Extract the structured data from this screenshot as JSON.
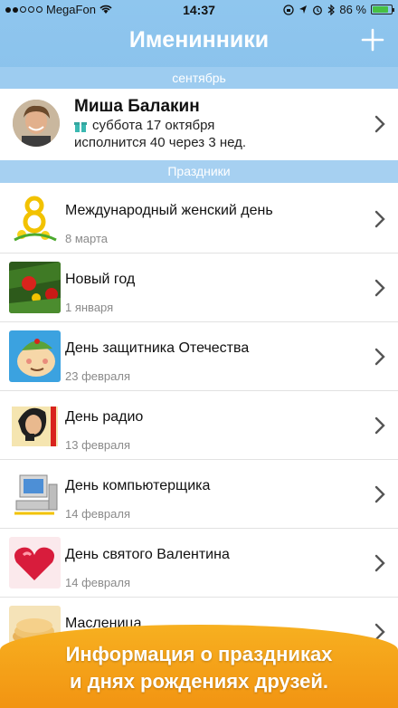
{
  "status_bar": {
    "carrier": "MegaFon",
    "time": "14:37",
    "battery": "86 %",
    "battery_level": 0.86
  },
  "header": {
    "title": "Именинники",
    "add_icon": "plus-icon"
  },
  "birthdays": {
    "section_label": "сентябрь",
    "person": {
      "name": "Миша Балакин",
      "date": "суббота 17 октября",
      "age_note": "исполнится 40 через 3 нед."
    }
  },
  "holidays": {
    "section_label": "Праздники",
    "items": [
      {
        "title": "Международный женский день",
        "date": "8 марта",
        "icon": "march8-icon"
      },
      {
        "title": "Новый год",
        "date": "1 января",
        "icon": "christmas-tree-icon"
      },
      {
        "title": "День защитника Отечества",
        "date": "23 февраля",
        "icon": "soldier-icon"
      },
      {
        "title": "День радио",
        "date": "13 февраля",
        "icon": "radio-icon"
      },
      {
        "title": "День компьютерщика",
        "date": "14 февраля",
        "icon": "computer-icon"
      },
      {
        "title": "День святого Валентина",
        "date": "14 февраля",
        "icon": "heart-icon"
      },
      {
        "title": "Масленица",
        "date": "",
        "icon": "pancakes-icon"
      }
    ]
  },
  "promo_banner": {
    "line1": "Информация о праздниках",
    "line2": "и днях рождениях друзей."
  },
  "colors": {
    "header_bg": "#8ac2ec",
    "banner": "#f29412",
    "accent_text": "#ffffff"
  }
}
